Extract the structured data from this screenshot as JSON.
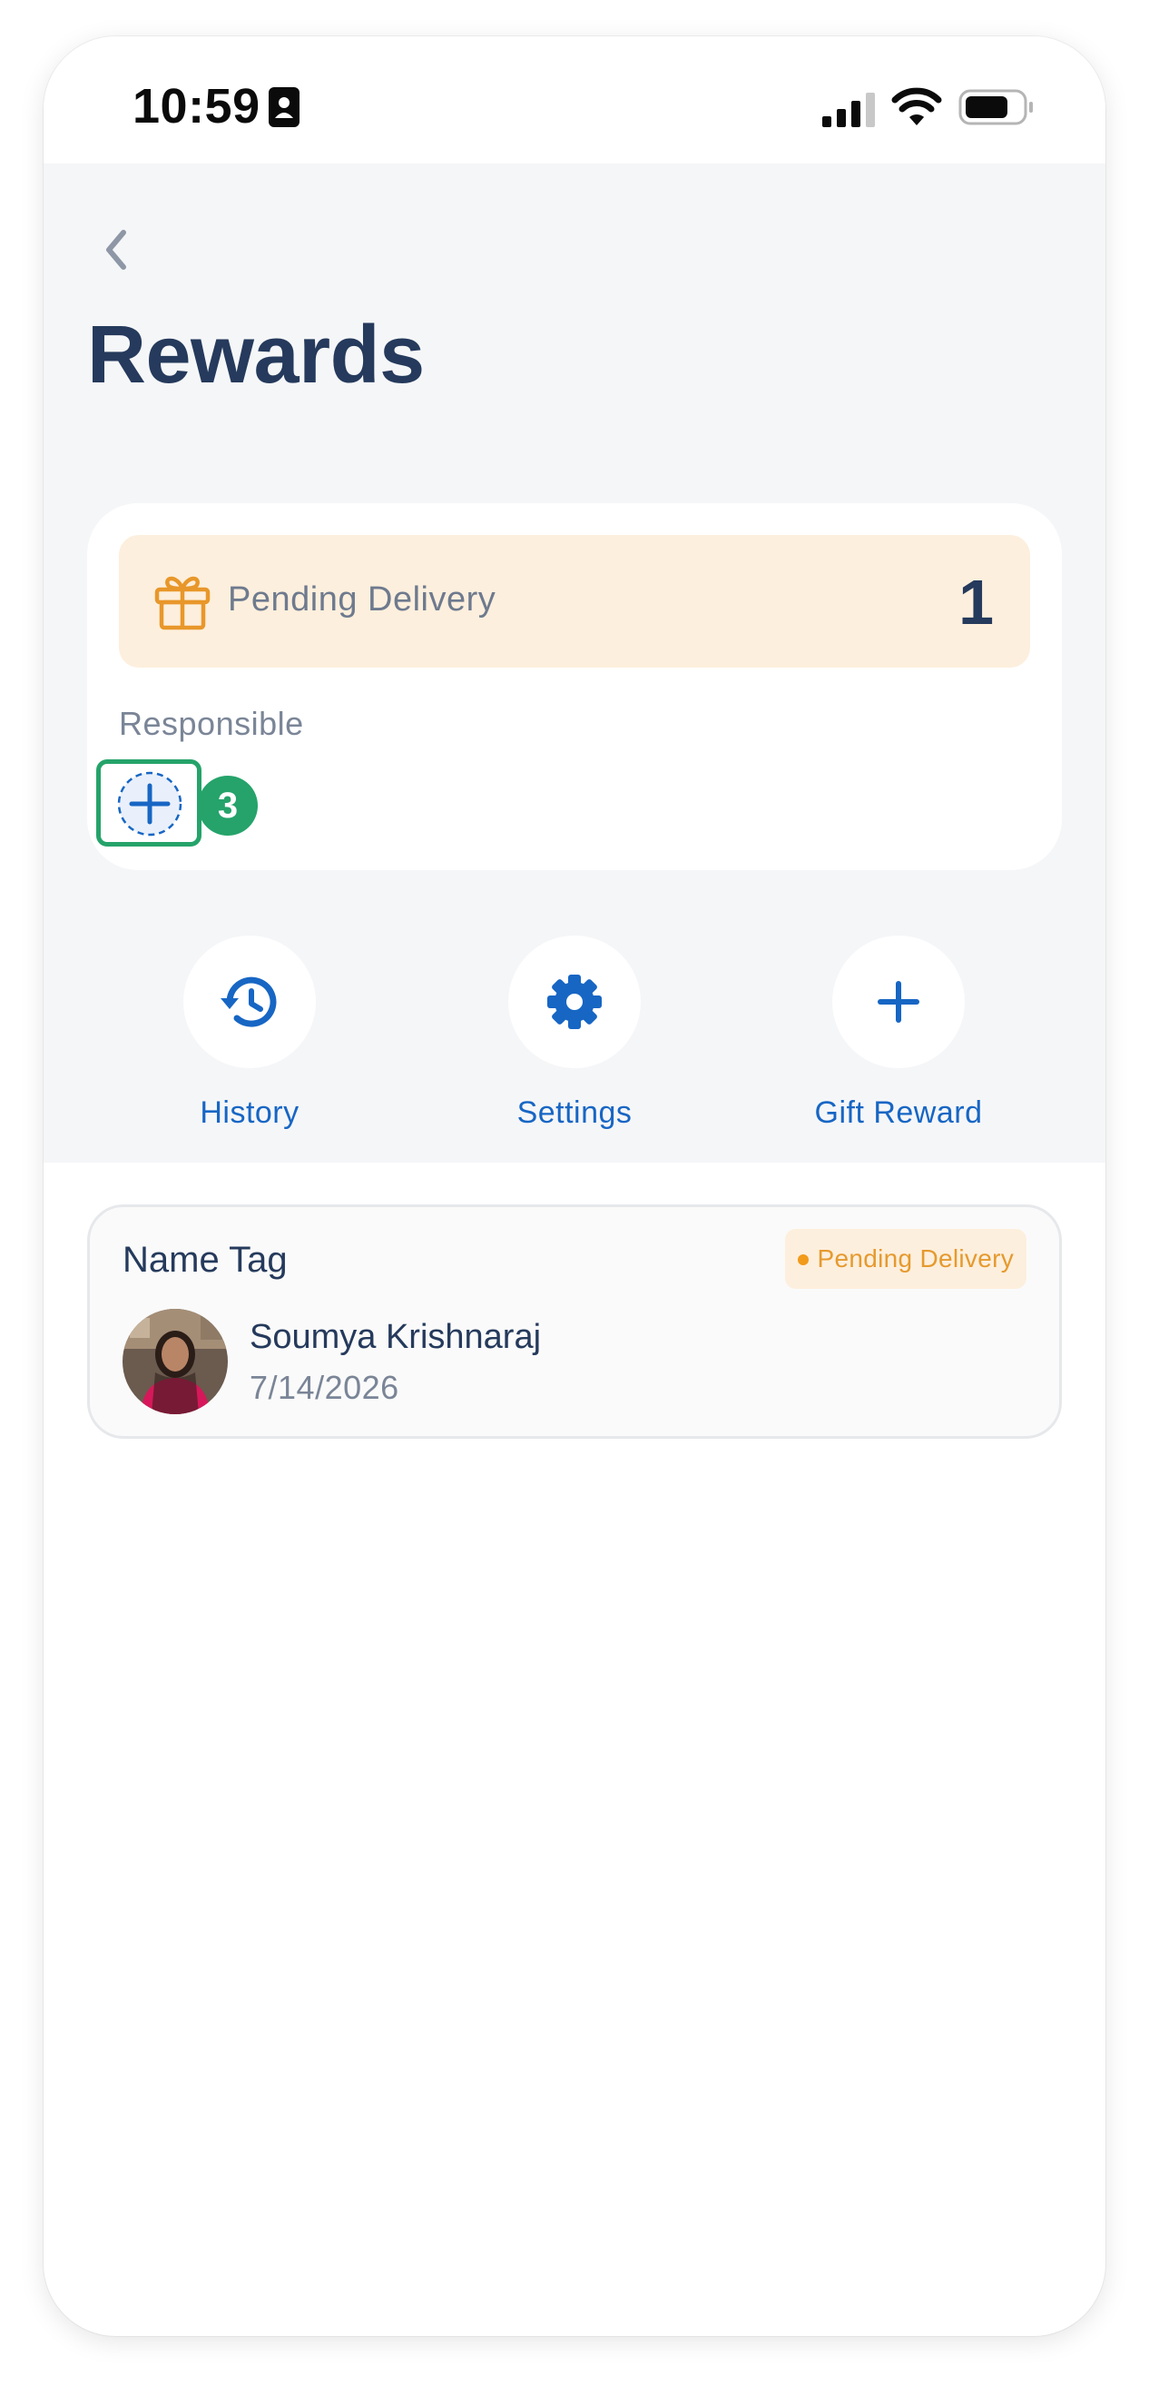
{
  "status_bar": {
    "time": "10:59"
  },
  "header": {
    "title": "Rewards"
  },
  "summary": {
    "pending_label": "Pending Delivery",
    "pending_count": "1",
    "responsible_label": "Responsible",
    "responsible_count": "3"
  },
  "actions": [
    {
      "label": "History",
      "icon": "history-icon"
    },
    {
      "label": "Settings",
      "icon": "gear-icon"
    },
    {
      "label": "Gift Reward",
      "icon": "plus-icon"
    }
  ],
  "rewards": [
    {
      "name": "Name Tag",
      "status": "Pending Delivery",
      "person": "Soumya Krishnaraj",
      "date": "7/14/2026"
    }
  ],
  "colors": {
    "accent": "#1766c4",
    "title": "#253a5c",
    "pending_bg": "#fdefdd",
    "pending_text": "#e59a2f",
    "highlight": "#25a36a"
  }
}
